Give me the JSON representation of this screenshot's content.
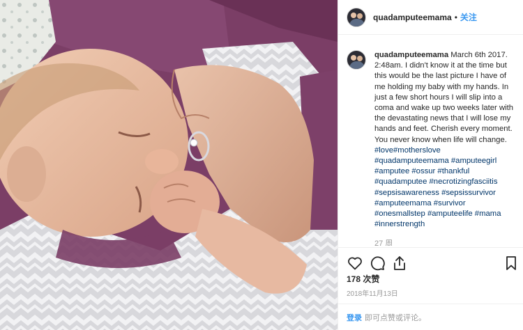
{
  "post": {
    "username": "quadamputeemama",
    "separator": "•",
    "follow_label": "关注",
    "caption": {
      "username": "quadamputeemama",
      "body": "March 6th 2017. 2:48am. I didn't know it at the time but this would be the last picture I have of me holding my baby with my hands. In just a few short hours I will slip into a coma and wake up two weeks later with the devastating news that I will lose my hands and feet. Cherish every moment. You never know when life will change.",
      "hashtags": "#love#motherslove #quadamputeemama #amputeegirl #amputee #ossur #thankful #quadamputee #necrotizingfasciitis #sepsisawareness #sepsissurvivor #amputeemama #survivor #onesmallstep #amputeelife #mama #innerstrength"
    },
    "comments_count": "27 周",
    "likes": "178 次赞",
    "date": "2018年11月13日",
    "login_link": "登录",
    "login_hint": "即可点赞或评论。"
  },
  "colors": {
    "link": "#003569",
    "accent": "#3897f0",
    "muted": "#999999",
    "text": "#262626",
    "border": "#efefef"
  },
  "icons": [
    "heart-icon",
    "comment-icon",
    "share-icon",
    "bookmark-icon"
  ]
}
